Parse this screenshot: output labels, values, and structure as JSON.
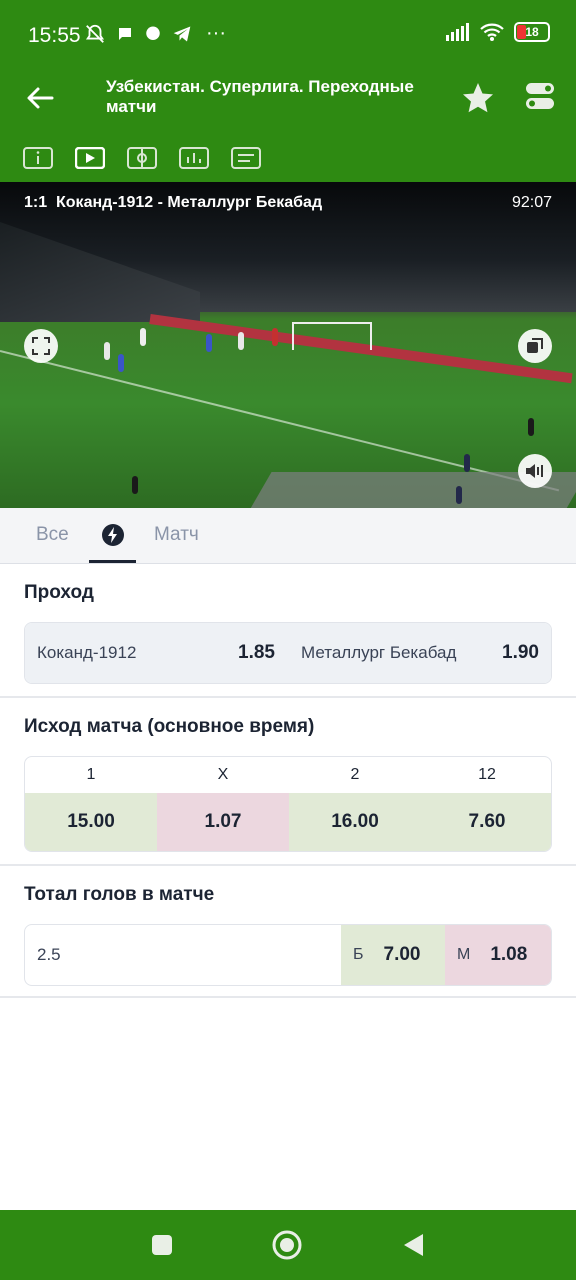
{
  "status_bar": {
    "time": "15:55",
    "battery": "18",
    "icons": [
      "mute-icon",
      "chat-bubble-icon",
      "message-icon",
      "telegram-icon",
      "more-dots-icon",
      "signal-icon",
      "wifi-icon",
      "battery-icon"
    ],
    "more_glyph": "···"
  },
  "header": {
    "title": "Узбекистан. Суперлига. Переходные матчи",
    "icons": [
      "back-arrow-icon",
      "star-icon",
      "toggle-settings-icon"
    ],
    "tab_icons": [
      "info-icon",
      "video-play-icon",
      "field-icon",
      "stats-icon",
      "text-broadcast-icon"
    ]
  },
  "video": {
    "score": "1:1",
    "match": "Коканд-1912 - Металлург Бекабад",
    "time": "92:07"
  },
  "market_tabs": {
    "all": "Все",
    "match": "Матч",
    "active_icon": "lightning-icon"
  },
  "pass": {
    "title": "Проход",
    "options": [
      {
        "team": "Коканд-1912",
        "coef": "1.85"
      },
      {
        "team": "Металлург Бекабад",
        "coef": "1.90"
      }
    ]
  },
  "result": {
    "title": "Исход матча (основное время)",
    "headers": [
      "1",
      "X",
      "2",
      "12"
    ],
    "values": [
      "15.00",
      "1.07",
      "16.00",
      "7.60"
    ]
  },
  "total": {
    "title": "Тотал голов в матче",
    "line": "2.5",
    "over_label": "Б",
    "over_coef": "7.00",
    "under_label": "М",
    "under_coef": "1.08"
  },
  "colors": {
    "brand_green": "#2e8a12",
    "up_green": "#e1ead6",
    "down_pink": "#ecd7df",
    "neutral": "#eef1f5"
  },
  "nav_bar": {
    "icons": [
      "recent-apps-icon",
      "home-icon",
      "back-icon"
    ]
  }
}
